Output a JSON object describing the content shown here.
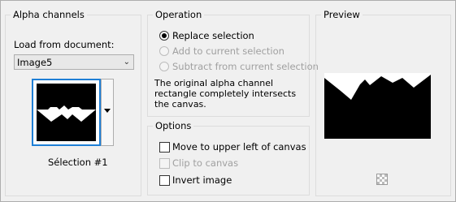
{
  "alpha_channels": {
    "title": "Alpha channels",
    "load_from_label": "Load from document:",
    "document_value": "Image5",
    "selection_caption": "Sélection #1"
  },
  "operation": {
    "title": "Operation",
    "options": [
      {
        "label": "Replace selection",
        "selected": true,
        "enabled": true
      },
      {
        "label": "Add to current selection",
        "selected": false,
        "enabled": false
      },
      {
        "label": "Subtract from current selection",
        "selected": false,
        "enabled": false
      }
    ],
    "info_text": "The original alpha channel rectangle completely intersects the canvas."
  },
  "options": {
    "title": "Options",
    "items": [
      {
        "label": "Move to upper left of canvas",
        "checked": false,
        "enabled": true
      },
      {
        "label": "Clip to canvas",
        "checked": false,
        "enabled": false
      },
      {
        "label": "Invert image",
        "checked": false,
        "enabled": true
      }
    ]
  },
  "preview": {
    "title": "Preview"
  },
  "colors": {
    "accent": "#1e7fd6",
    "background": "#f0f0f0"
  }
}
